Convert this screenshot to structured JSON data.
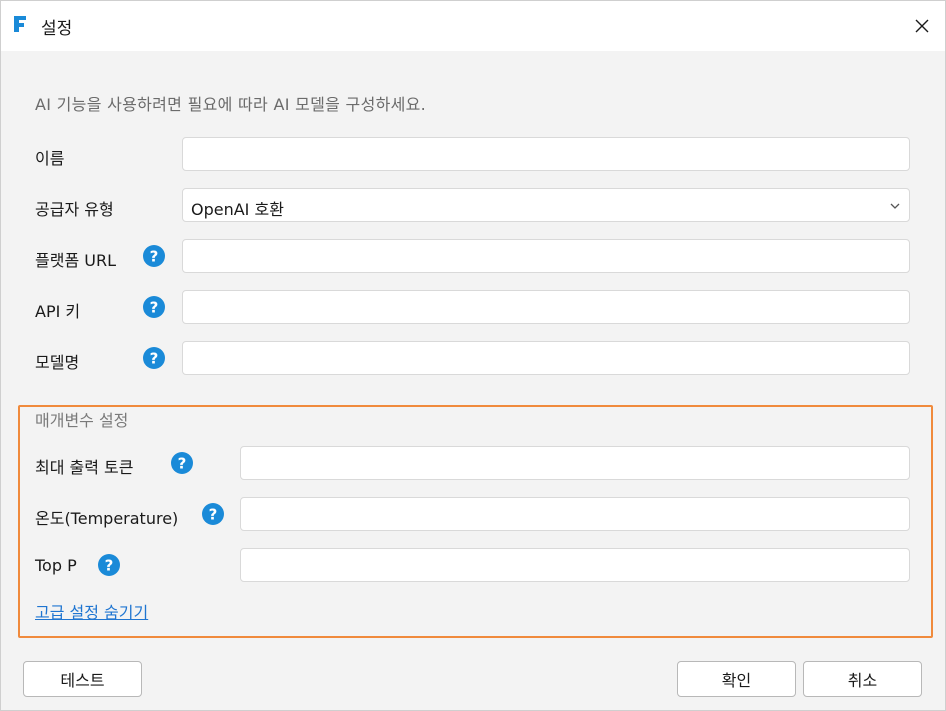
{
  "window": {
    "title": "설정",
    "app_icon_letter": "F"
  },
  "description": "AI 기능을 사용하려면 필요에 따라 AI 모델을 구성하세요.",
  "fields": {
    "name": {
      "label": "이름",
      "value": ""
    },
    "provider_type": {
      "label": "공급자 유형",
      "value": "OpenAI 호환"
    },
    "platform_url": {
      "label": "플랫폼 URL",
      "value": ""
    },
    "api_key": {
      "label": "API 키",
      "value": ""
    },
    "model_name": {
      "label": "모델명",
      "value": ""
    }
  },
  "parameters": {
    "title": "매개변수 설정",
    "max_tokens": {
      "label": "최대 출력 토큰",
      "value": ""
    },
    "temperature": {
      "label": "온도(Temperature)",
      "value": ""
    },
    "top_p": {
      "label": "Top P",
      "value": ""
    },
    "toggle_link": "고급 설정 숨기기"
  },
  "buttons": {
    "test": "테스트",
    "ok": "확인",
    "cancel": "취소"
  },
  "colors": {
    "help_icon": "#1a8ad8",
    "group_border": "#f08a3c",
    "link": "#1f75d1",
    "app_icon": "#1a8ad8"
  }
}
